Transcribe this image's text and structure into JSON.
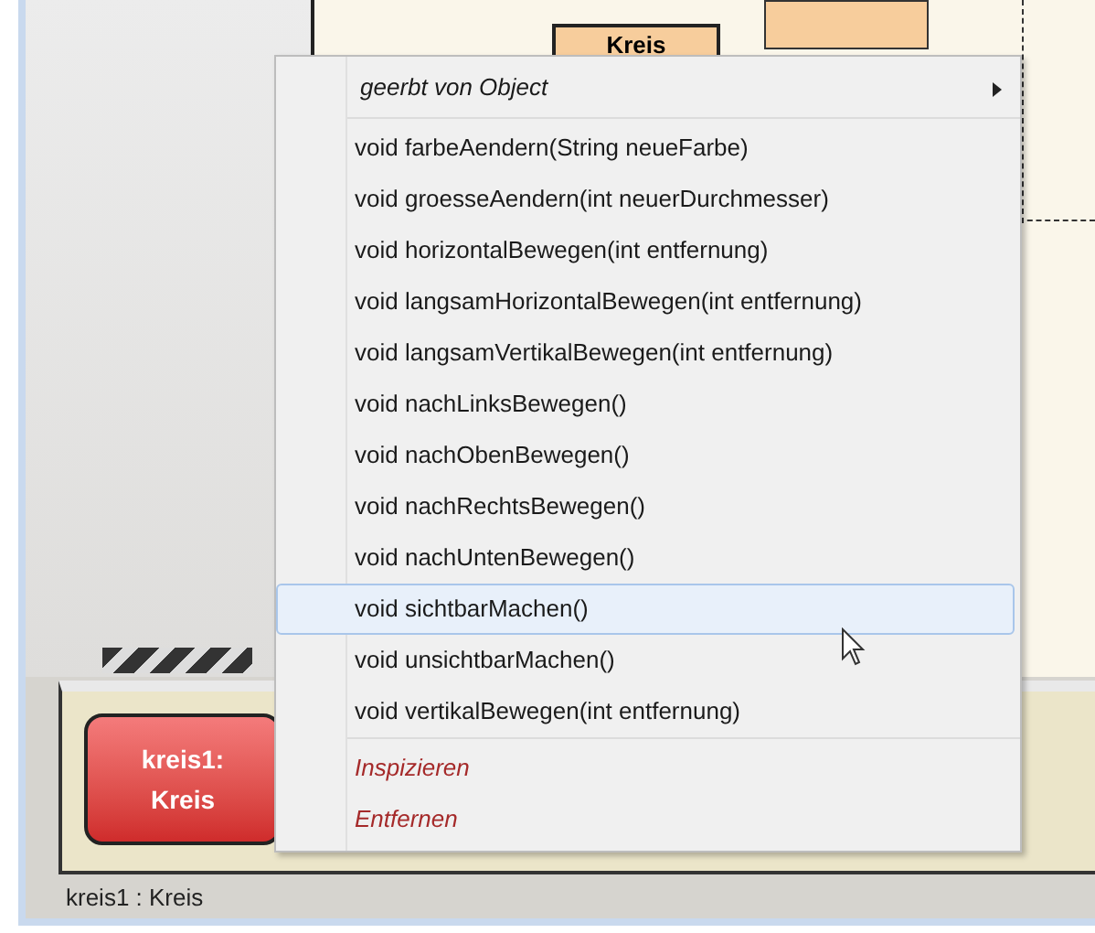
{
  "diagram": {
    "classes": [
      {
        "name": "Kreis"
      }
    ]
  },
  "context_menu": {
    "items": [
      {
        "kind": "submenu",
        "label": "geerbt von Object",
        "selected": false
      },
      {
        "kind": "method",
        "label": "void farbeAendern(String neueFarbe)",
        "selected": false
      },
      {
        "kind": "method",
        "label": "void groesseAendern(int neuerDurchmesser)",
        "selected": false
      },
      {
        "kind": "method",
        "label": "void horizontalBewegen(int entfernung)",
        "selected": false
      },
      {
        "kind": "method",
        "label": "void langsamHorizontalBewegen(int entfernung)",
        "selected": false
      },
      {
        "kind": "method",
        "label": "void langsamVertikalBewegen(int entfernung)",
        "selected": false
      },
      {
        "kind": "method",
        "label": "void nachLinksBewegen()",
        "selected": false
      },
      {
        "kind": "method",
        "label": "void nachObenBewegen()",
        "selected": false
      },
      {
        "kind": "method",
        "label": "void nachRechtsBewegen()",
        "selected": false
      },
      {
        "kind": "method",
        "label": "void nachUntenBewegen()",
        "selected": false
      },
      {
        "kind": "method",
        "label": "void sichtbarMachen()",
        "selected": true
      },
      {
        "kind": "method",
        "label": "void unsichtbarMachen()",
        "selected": false
      },
      {
        "kind": "method",
        "label": "void vertikalBewegen(int entfernung)",
        "selected": false
      },
      {
        "kind": "action",
        "label": "Inspizieren",
        "selected": false
      },
      {
        "kind": "action",
        "label": "Entfernen",
        "selected": false
      }
    ]
  },
  "object_bench": {
    "objects": [
      {
        "name": "kreis1:",
        "class": "Kreis",
        "caption": "kreis1 : Kreis"
      }
    ]
  }
}
